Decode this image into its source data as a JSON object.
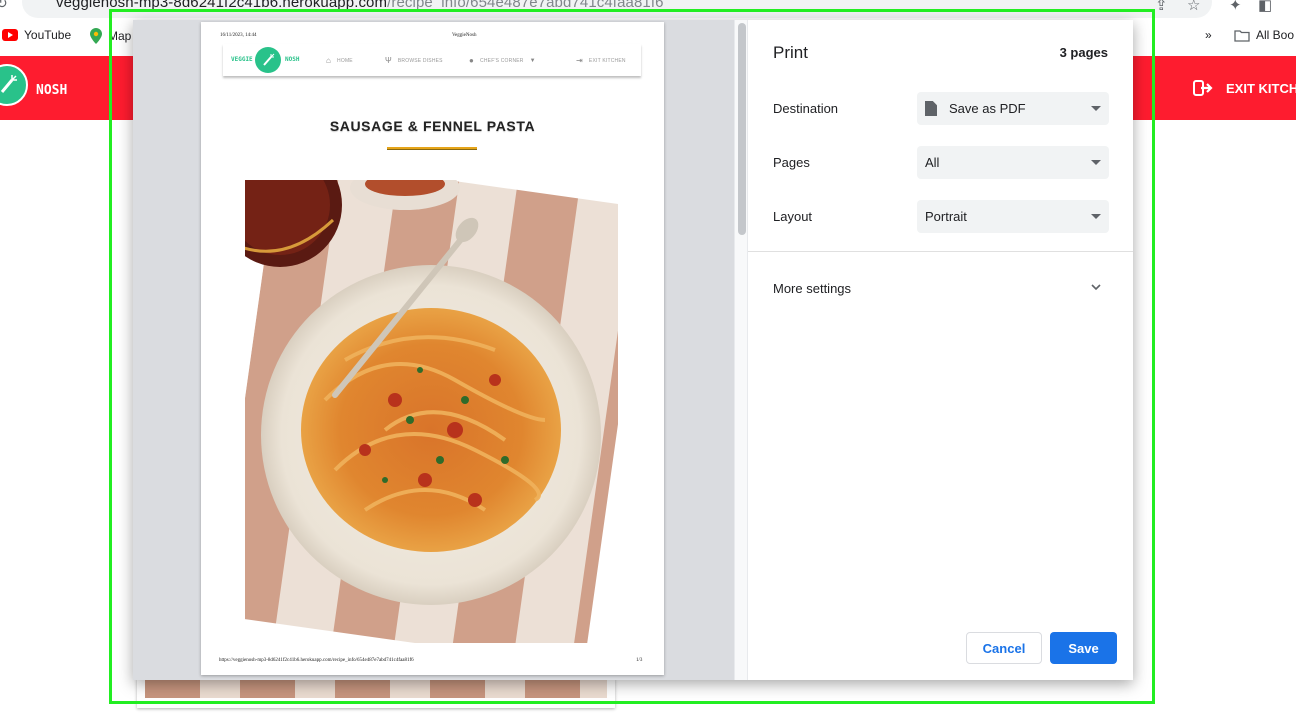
{
  "browser": {
    "url_host": "vegglenosh-mp3-8d6241f2c41b6.herokuapp.com",
    "url_path": "/recipe_info/654e487e7abd741c4faa81f6",
    "bookmarks": [
      {
        "label": "YouTube",
        "icon": "youtube-icon"
      },
      {
        "label": "Map",
        "icon": "maps-pin-icon"
      }
    ],
    "bookmarks_folder": "All Boo",
    "overflow": "»"
  },
  "site": {
    "logo_text": "NOSH",
    "exit_label": "EXIT KITCHE",
    "nav_color": "#fe1c2f",
    "brand_color": "#29c28a"
  },
  "preview": {
    "header_date": "16/11/2023, 14:44",
    "header_site": "VeggieNosh",
    "mini_logo_left": "VEGGIE",
    "mini_logo_right": "NOSH",
    "mini_nav": [
      {
        "label": "HOME",
        "icon": "house-icon"
      },
      {
        "label": "BROWSE DISHES",
        "icon": "utensils-icon"
      },
      {
        "label": "CHEF'S CORNER",
        "icon": "user-circle-icon"
      },
      {
        "label": "EXIT KITCHEN",
        "icon": "exit-icon"
      }
    ],
    "recipe_title": "SAUSAGE & FENNEL PASTA",
    "footer_url": "https://veggienosh-mp3-8d6241f2c41b6.herokuapp.com/recipe_info/654e487e7abd741c4faa81f6",
    "footer_page": "1/3"
  },
  "print": {
    "title": "Print",
    "page_count": "3 pages",
    "destination_label": "Destination",
    "destination_value": "Save as PDF",
    "pages_label": "Pages",
    "pages_value": "All",
    "layout_label": "Layout",
    "layout_value": "Portrait",
    "more_settings": "More settings",
    "cancel": "Cancel",
    "save": "Save",
    "accent_color": "#1a73e8"
  }
}
